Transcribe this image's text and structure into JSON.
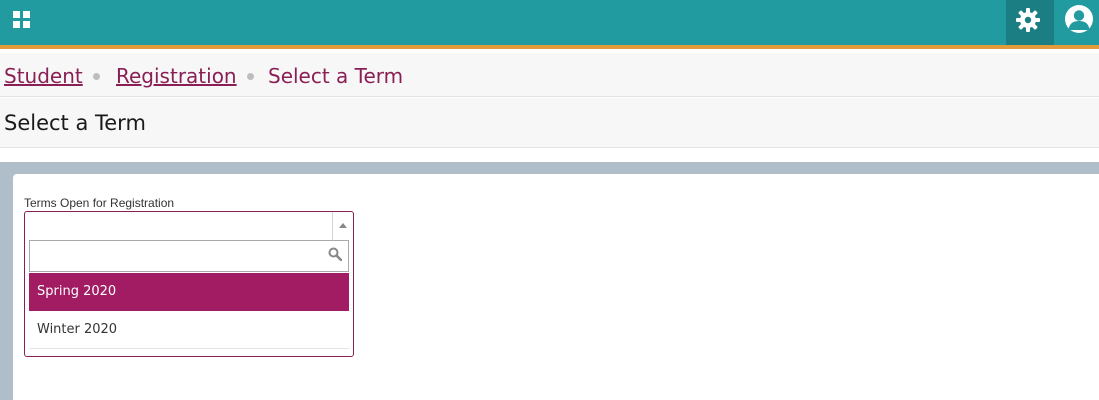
{
  "header": {
    "brand_color": "#219b9f",
    "accent_color": "#e39a3a",
    "apps_icon": "grid-icon",
    "settings_icon": "gear-icon",
    "user_icon": "user-avatar-icon"
  },
  "breadcrumb": {
    "items": [
      {
        "label": "Student",
        "link": true
      },
      {
        "label": "Registration",
        "link": true
      },
      {
        "label": "Select a Term",
        "link": false
      }
    ]
  },
  "page": {
    "title": "Select a Term"
  },
  "term_select": {
    "label": "Terms Open for Registration",
    "selected_value": "",
    "search_value": "",
    "search_placeholder": "",
    "options": [
      {
        "label": "Spring 2020",
        "highlighted": true
      },
      {
        "label": "Winter 2020",
        "highlighted": false
      }
    ],
    "highlight_color": "#a21c63"
  }
}
